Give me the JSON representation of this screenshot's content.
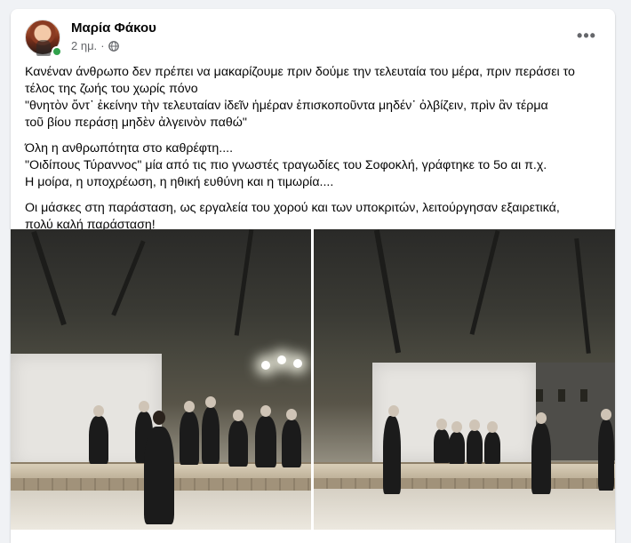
{
  "post": {
    "author": "Μαρία Φάκου",
    "timestamp": "2 ημ.",
    "privacy_icon": "globe-icon",
    "more_icon": "more-options-icon",
    "more_label": "•••",
    "text": {
      "p1": [
        "Κανέναν άνθρωπο δεν πρέπει να μακαρίζουμε πριν δούμε την τελευταία του μέρα, πριν περάσει το",
        "τέλος της ζωής του χωρίς πόνο",
        "\"θνητὸν ὄντ᾽ ἐκείνην τὴν τελευταίαν ἰδεῖν ἡμέραν ἐπισκοποῦντα μηδέν᾽ ὀλβίζειν, πρὶν ἂν τέρμα",
        "τοῦ βίου περάσῃ μηδὲν ἀλγεινὸν παθώ\""
      ],
      "p2": [
        "Όλη η ανθρωπότητα στο καθρέφτη....",
        "\"Οιδίπους Τύραννος\" μία από τις πιο γνωστές τραγωδίες του Σοφοκλή, γράφτηκε το 5ο αι π.χ.",
        "Η μοίρα, η υποχρέωση, η ηθική ευθύνη και η τιμωρία...."
      ],
      "p3": [
        "Οι μάσκες στη παράσταση, ως εργαλεία του χορού και των υποκριτών, λειτούργησαν εξαιρετικά,",
        "πολύ καλή παράσταση!"
      ]
    },
    "photos": [
      {
        "name": "theatre-photo-left"
      },
      {
        "name": "theatre-photo-right"
      }
    ]
  },
  "colors": {
    "online": "#31a24c",
    "meta_text": "#65676b",
    "background": "#f0f2f5",
    "card": "#ffffff"
  }
}
